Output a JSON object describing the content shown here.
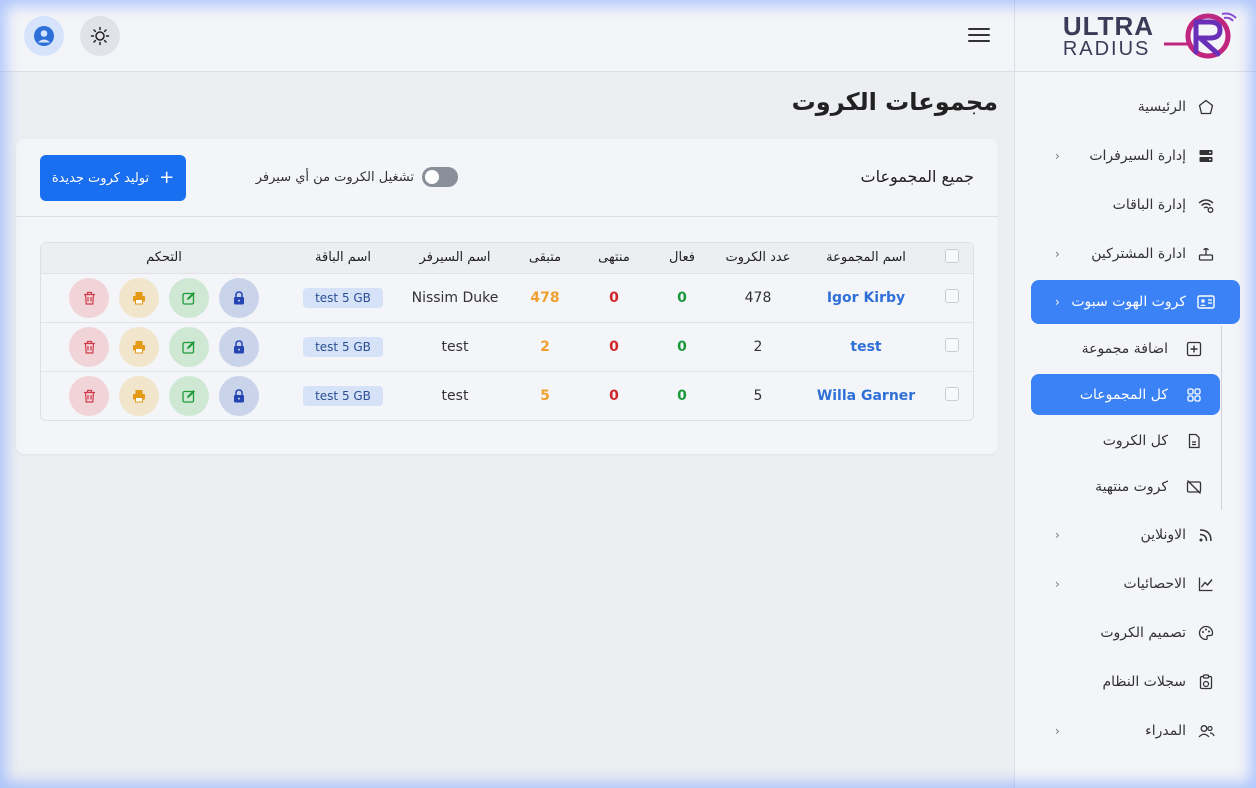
{
  "logo": {
    "line1": "ULTRA",
    "line2": "RADIUS"
  },
  "sidebar": {
    "items": [
      {
        "label": "الرئيسية",
        "icon": "home-icon",
        "chevron": false
      },
      {
        "label": "إدارة السيرفرات",
        "icon": "server-icon",
        "chevron": true
      },
      {
        "label": "إدارة الباقات",
        "icon": "wifi-settings-icon",
        "chevron": false
      },
      {
        "label": "ادارة المشتركين",
        "icon": "router-icon",
        "chevron": true
      },
      {
        "label": "كروت الهوت سبوت",
        "icon": "id-card-icon",
        "chevron": true,
        "active": true
      }
    ],
    "subitems": [
      {
        "label": "اضافة مجموعة",
        "icon": "plus-square-icon"
      },
      {
        "label": "كل المجموعات",
        "icon": "grid-icon",
        "active": true
      },
      {
        "label": "كل الكروت",
        "icon": "file-icon"
      },
      {
        "label": "كروت منتهية",
        "icon": "card-off-icon"
      }
    ],
    "items2": [
      {
        "label": "الاونلاين",
        "icon": "rss-icon",
        "chevron": true
      },
      {
        "label": "الاحصائيات",
        "icon": "chart-line-icon",
        "chevron": true
      },
      {
        "label": "تصميم الكروت",
        "icon": "palette-icon",
        "chevron": false
      },
      {
        "label": "سجلات النظام",
        "icon": "clipboard-icon",
        "chevron": false
      },
      {
        "label": "المدراء",
        "icon": "users-icon",
        "chevron": true
      }
    ]
  },
  "page": {
    "title": "مجموعات الكروت"
  },
  "card": {
    "title": "جميع المجموعات",
    "toggle_label": "تشغيل الكروت من أي سيرفر",
    "generate_button": "توليد كروت جديدة"
  },
  "table": {
    "headers": [
      "اسم المجموعة",
      "عدد الكروت",
      "فعال",
      "منتهى",
      "متبقى",
      "اسم السيرفر",
      "اسم الباقة",
      "التحكم"
    ],
    "rows": [
      {
        "name": "Igor Kirby",
        "count": "478",
        "active": "0",
        "expired": "0",
        "remaining": "478",
        "server": "Nissim Duke",
        "package": "test 5 GB"
      },
      {
        "name": "test",
        "count": "2",
        "active": "0",
        "expired": "0",
        "remaining": "2",
        "server": "test",
        "package": "test 5 GB"
      },
      {
        "name": "Willa Garner",
        "count": "5",
        "active": "0",
        "expired": "0",
        "remaining": "5",
        "server": "test",
        "package": "test 5 GB"
      }
    ]
  },
  "colors": {
    "accent": "#3b82f6",
    "primary_button": "#1a6ff0",
    "green": "#1b9a3c",
    "red": "#d0252a",
    "orange": "#f0a030"
  }
}
